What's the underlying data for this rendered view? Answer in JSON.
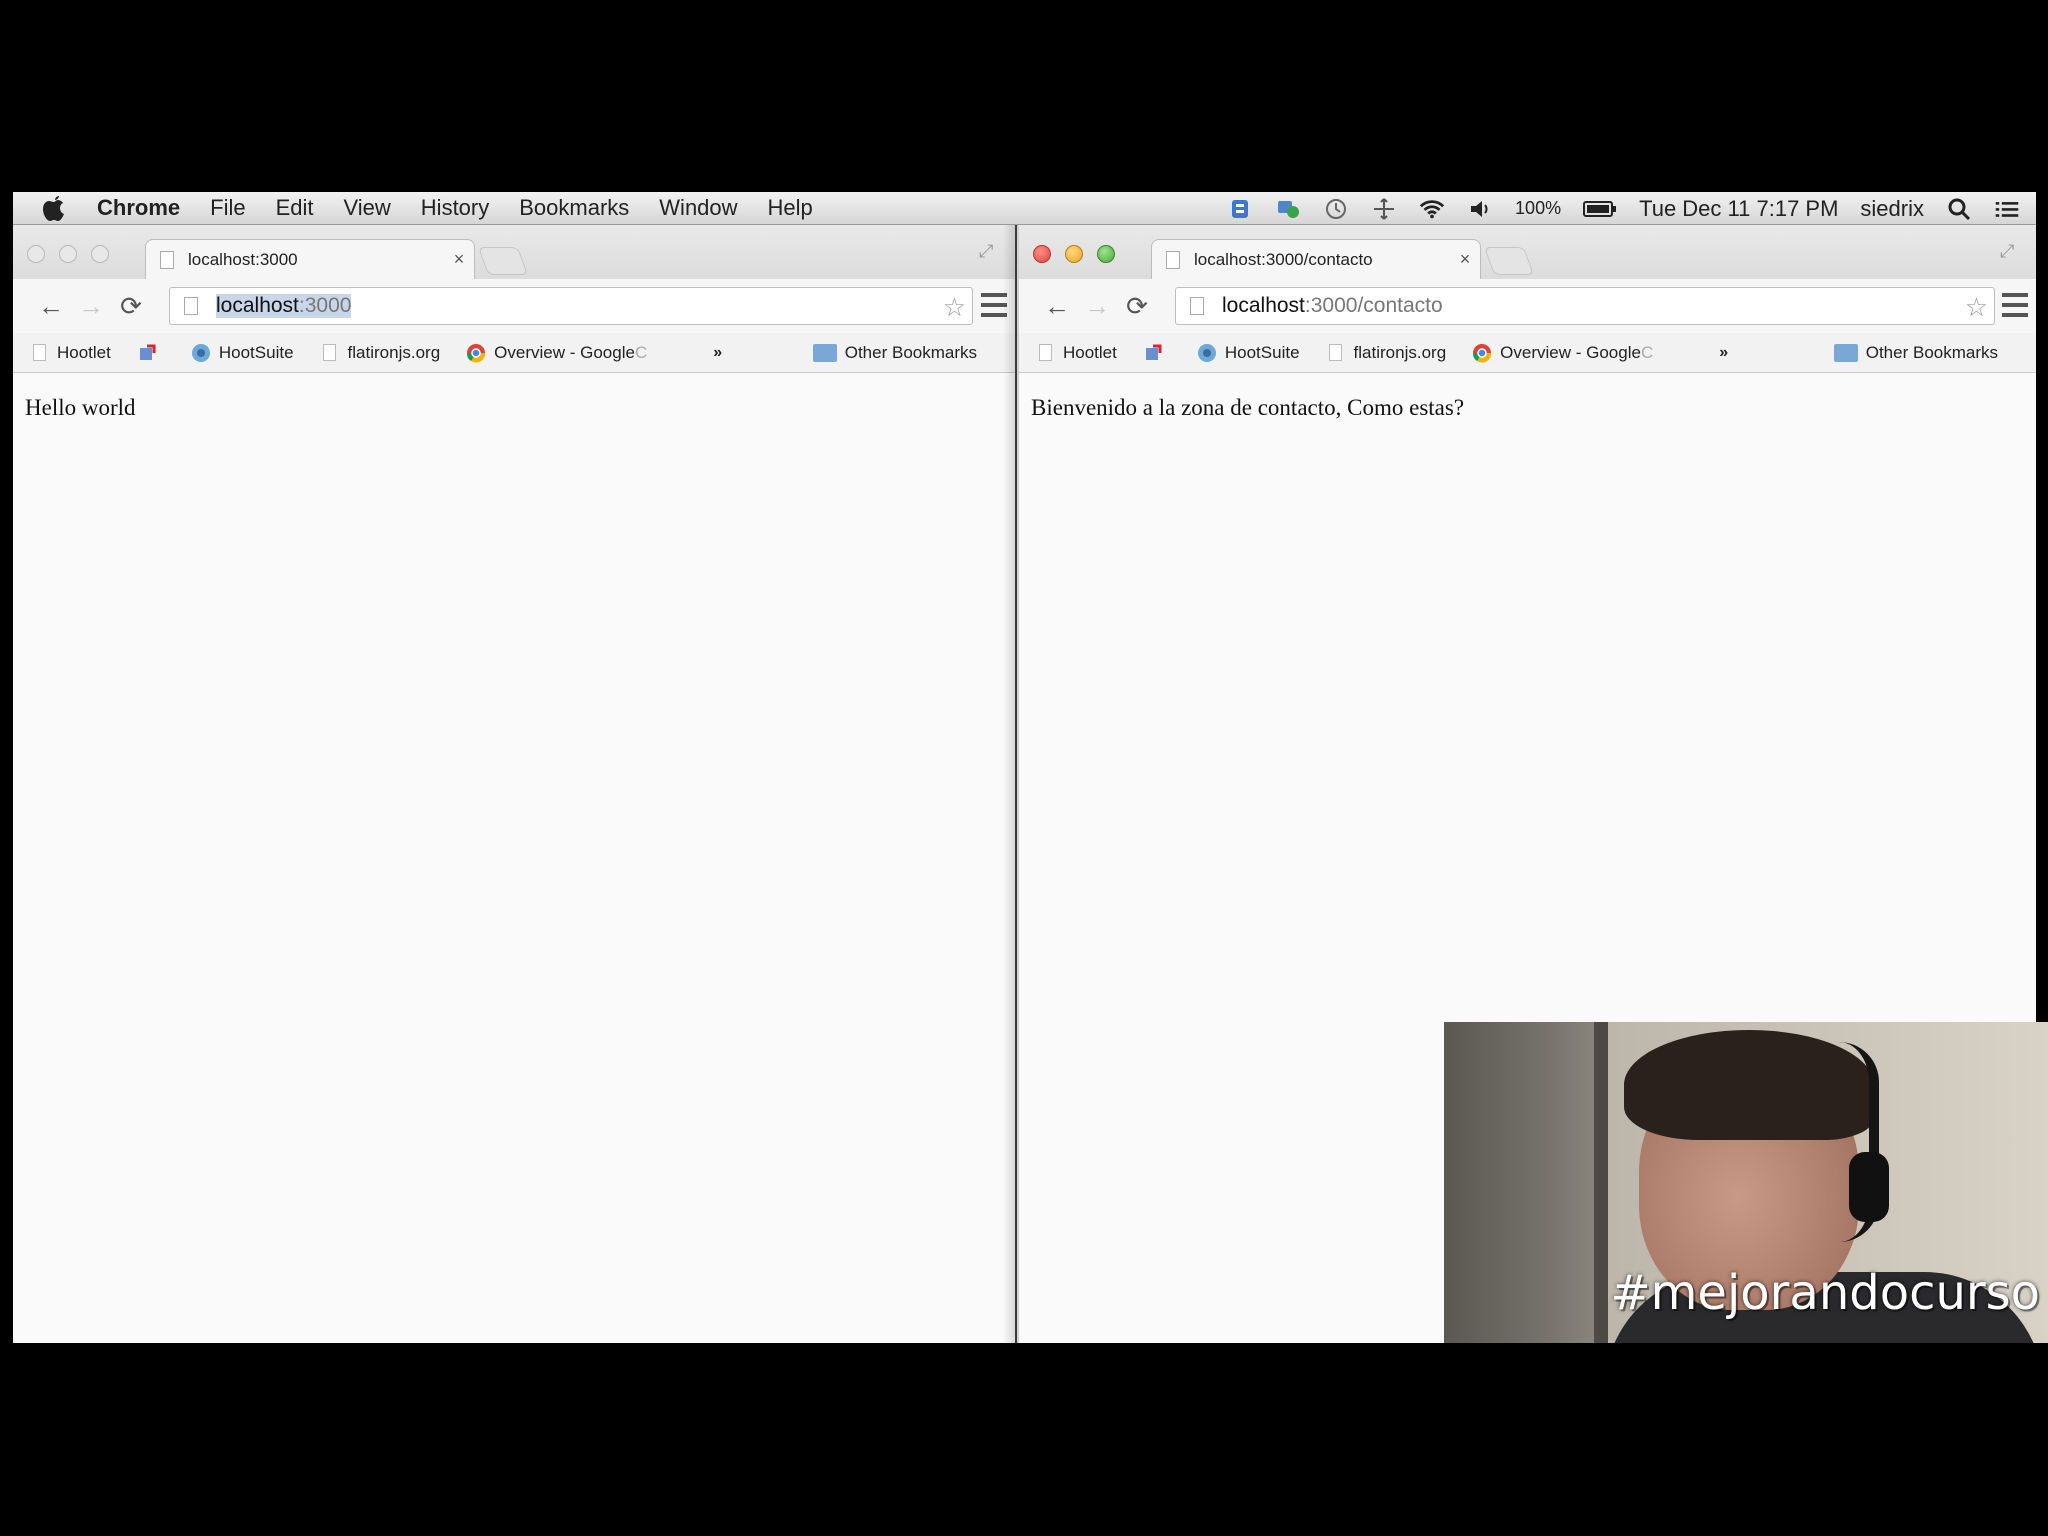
{
  "menubar": {
    "app_name": "Chrome",
    "items": [
      "File",
      "Edit",
      "View",
      "History",
      "Bookmarks",
      "Window",
      "Help"
    ],
    "battery": "100%",
    "clock": "Tue Dec 11  7:17 PM",
    "user": "siedrix"
  },
  "left_window": {
    "tab_title": "localhost:3000",
    "url_host": "localhost",
    "url_rest": ":3000",
    "page_text": "Hello world"
  },
  "right_window": {
    "tab_title": "localhost:3000/contacto",
    "url_host": "localhost",
    "url_rest": ":3000/contacto",
    "page_text": "Bienvenido a la zona de contacto, Como estas?"
  },
  "bookmarks": {
    "hootlet": "Hootlet",
    "hootsuite": "HootSuite",
    "flatiron": "flatironjs.org",
    "overview": "Overview - Google",
    "overview_fade": "C",
    "chevron": "»",
    "other": "Other Bookmarks"
  },
  "tab_close": "×",
  "webcam": {
    "caption": "#mejorandocurso"
  },
  "colors": {
    "accent_blue": "#4a7fc1",
    "close_red": "#e0443a",
    "minimize_yellow": "#e8a526",
    "zoom_green": "#4aa63c"
  }
}
